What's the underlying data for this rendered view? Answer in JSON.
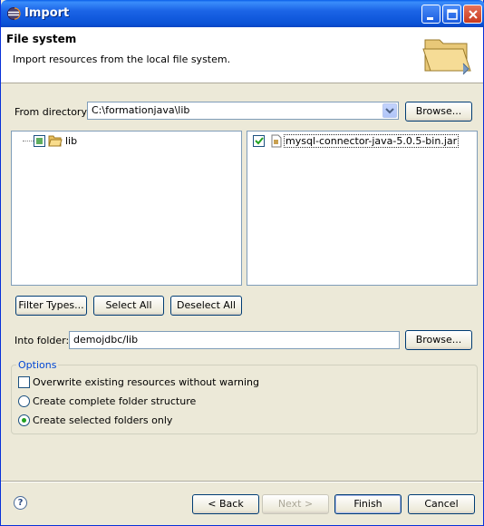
{
  "window": {
    "title": "Import"
  },
  "header": {
    "title": "File system",
    "description": "Import resources from the local file system."
  },
  "from_directory": {
    "label": "From directory:",
    "value": "C:\\formationjava\\lib",
    "browse_label": "Browse..."
  },
  "folder_tree": {
    "items": [
      {
        "label": "lib",
        "checked": "partial",
        "icon": "folder-icon"
      }
    ]
  },
  "file_list": {
    "items": [
      {
        "label": "mysql-connector-java-5.0.5-bin.jar",
        "checked": true,
        "icon": "jar-file-icon"
      }
    ]
  },
  "selection_buttons": {
    "filter_types": "Filter Types...",
    "select_all": "Select All",
    "deselect_all": "Deselect All"
  },
  "into_folder": {
    "label": "Into folder:",
    "value": "demojdbc/lib",
    "browse_label": "Browse..."
  },
  "options": {
    "group_label": "Options",
    "overwrite": {
      "label": "Overwrite existing resources without warning",
      "checked": false
    },
    "create_complete": {
      "label": "Create complete folder structure",
      "selected": false
    },
    "create_selected": {
      "label": "Create selected folders only",
      "selected": true
    }
  },
  "footer": {
    "help": "?",
    "back": "< Back",
    "next": "Next >",
    "finish": "Finish",
    "cancel": "Cancel"
  },
  "colors": {
    "titlebar": "#0a52d6",
    "dialog_bg": "#ece9d8",
    "accent_label": "#0046d5",
    "checkmark": "#21a121"
  }
}
